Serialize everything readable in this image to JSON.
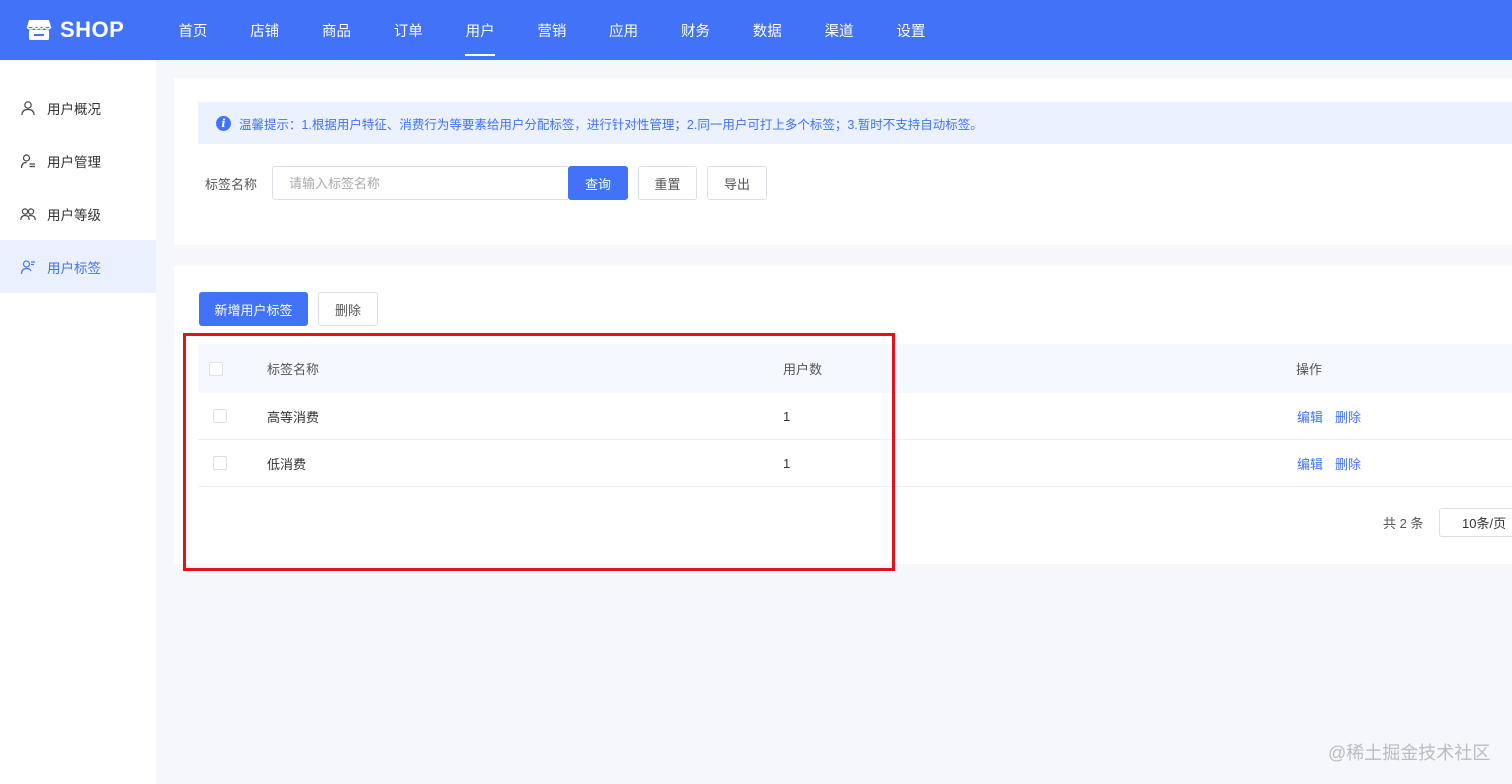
{
  "app": {
    "logo_text": "SHOP"
  },
  "nav": {
    "items": [
      "首页",
      "店铺",
      "商品",
      "订单",
      "用户",
      "营销",
      "应用",
      "财务",
      "数据",
      "渠道",
      "设置"
    ],
    "active": "用户"
  },
  "sidebar": {
    "items": [
      {
        "label": "用户概况",
        "icon": "user-icon"
      },
      {
        "label": "用户管理",
        "icon": "user-list-icon"
      },
      {
        "label": "用户等级",
        "icon": "user-group-icon"
      },
      {
        "label": "用户标签",
        "icon": "user-tag-icon"
      }
    ],
    "active": "用户标签"
  },
  "notice": {
    "text": "温馨提示：1.根据用户特征、消费行为等要素给用户分配标签，进行针对性管理；2.同一用户可打上多个标签；3.暂时不支持自动标签。"
  },
  "filter": {
    "label": "标签名称",
    "placeholder": "请输入标签名称",
    "value": "",
    "query_label": "查询",
    "reset_label": "重置",
    "export_label": "导出"
  },
  "toolbar": {
    "add_label": "新增用户标签",
    "delete_label": "删除"
  },
  "table": {
    "columns": [
      "标签名称",
      "用户数",
      "操作"
    ],
    "rows": [
      {
        "name": "高等消费",
        "count": "1",
        "actions": [
          "编辑",
          "删除"
        ]
      },
      {
        "name": "低消费",
        "count": "1",
        "actions": [
          "编辑",
          "删除"
        ]
      }
    ]
  },
  "pagination": {
    "total_text": "共 2 条",
    "page_size": "10条/页"
  },
  "colors": {
    "primary": "#4272f7",
    "highlight": "#e0121c"
  },
  "watermark": "@稀土掘金技术社区"
}
